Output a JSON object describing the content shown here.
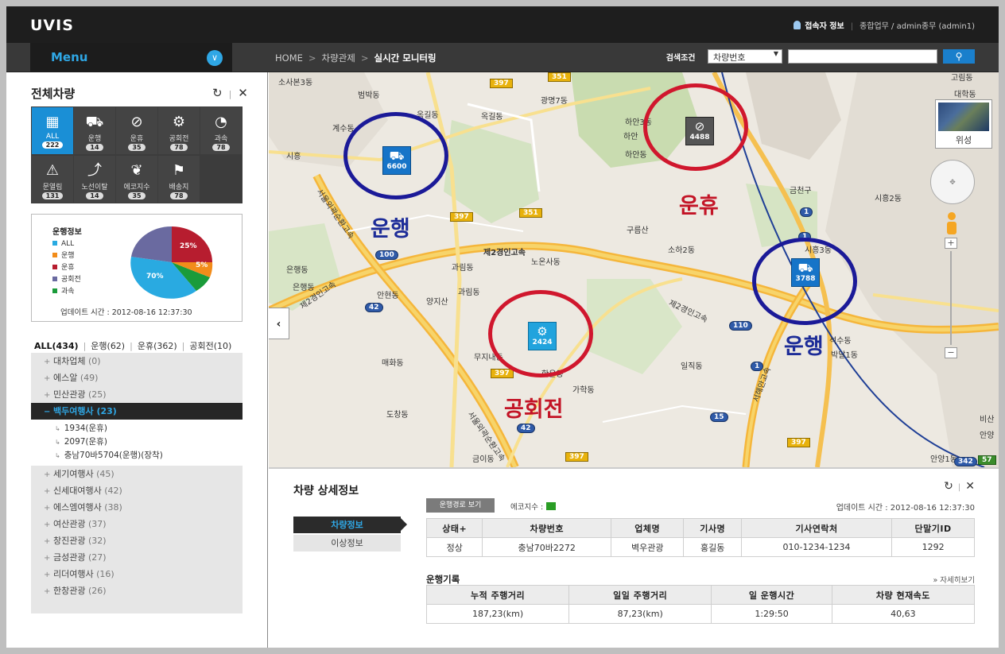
{
  "app": {
    "logo": "UVIS"
  },
  "user": {
    "label": "접속자 정보",
    "info": "종합업무 / admin종무 (admin1)"
  },
  "nav": {
    "menu_label": "Menu",
    "breadcrumb": [
      "HOME",
      "차량관제",
      "실시간 모니터링"
    ],
    "search_label": "검색조건",
    "search_select": "차량번호",
    "search_value": ""
  },
  "sidebar": {
    "title": "전체차량",
    "categories": [
      {
        "label": "ALL",
        "count": "222",
        "icon": "grid-icon"
      },
      {
        "label": "운행",
        "count": "14",
        "icon": "car-icon"
      },
      {
        "label": "운휴",
        "count": "35",
        "icon": "no-entry-icon"
      },
      {
        "label": "공회전",
        "count": "78",
        "icon": "gear-icon"
      },
      {
        "label": "과속",
        "count": "78",
        "icon": "speedometer-icon"
      },
      {
        "label": "문열림",
        "count": "131",
        "icon": "alert-icon"
      },
      {
        "label": "노선이탈",
        "count": "14",
        "icon": "detour-icon"
      },
      {
        "label": "에코지수",
        "count": "35",
        "icon": "leaf-icon"
      },
      {
        "label": "배송지",
        "count": "78",
        "icon": "flag-icon"
      }
    ],
    "pie": {
      "title": "운행정보",
      "legend": [
        {
          "label": "ALL",
          "color": "#29aae1"
        },
        {
          "label": "운행",
          "color": "#f28c1a"
        },
        {
          "label": "운휴",
          "color": "#b71d2f"
        },
        {
          "label": "공회전",
          "color": "#6a6aa0"
        },
        {
          "label": "과속",
          "color": "#1a9b3a"
        }
      ],
      "slice_labels": [
        "25%",
        "5%",
        "70%"
      ],
      "update": "업데이트 시간 : 2012-08-16 12:37:30"
    },
    "filter": [
      "ALL(434)",
      "운행(62)",
      "운휴(362)",
      "공회전(10)"
    ],
    "companies_top": [
      {
        "name": "대차업체",
        "count": "(0)"
      },
      {
        "name": "에스알",
        "count": "(49)"
      },
      {
        "name": "민산관광",
        "count": "(25)"
      }
    ],
    "open_company": {
      "name": "백두여행사",
      "count": "(23)"
    },
    "open_items": [
      "1934(운휴)",
      "2097(운휴)",
      "충남70바5704(운행)(장착)"
    ],
    "companies_bottom": [
      {
        "name": "세기여행사",
        "count": "(45)"
      },
      {
        "name": "신세대여행사",
        "count": "(42)"
      },
      {
        "name": "에스엠여행사",
        "count": "(38)"
      },
      {
        "name": "여산관광",
        "count": "(37)"
      },
      {
        "name": "창진관광",
        "count": "(32)"
      },
      {
        "name": "금성관광",
        "count": "(27)"
      },
      {
        "name": "리더여행사",
        "count": "(16)"
      },
      {
        "name": "한창관광",
        "count": "(26)"
      }
    ]
  },
  "map": {
    "satellite_label": "위성",
    "markers": [
      {
        "id": "6600",
        "status": "운행"
      },
      {
        "id": "4488",
        "status": "운휴"
      },
      {
        "id": "3788",
        "status": "운행"
      },
      {
        "id": "2424",
        "status": "공회전"
      }
    ],
    "places": [
      "소사본3동",
      "범박동",
      "옥길동",
      "광명7동",
      "옥길동",
      "하안3동",
      "하안동",
      "금천구",
      "시흥2동",
      "계수동",
      "시흥",
      "하안",
      "구름산",
      "소하2동",
      "시흥3동",
      "과림동",
      "노온사동",
      "은행동",
      "은행동",
      "안현동",
      "과림동",
      "양지산",
      "매화동",
      "무지내동",
      "학온동",
      "가학동",
      "일직동",
      "석수동",
      "박달1동",
      "도창동",
      "금이동",
      "비산",
      "안양1동",
      "대학동",
      "고림동",
      "안양"
    ],
    "roads": [
      "397",
      "351",
      "397",
      "351",
      "100",
      "42",
      "397",
      "110",
      "15",
      "42",
      "397",
      "397",
      "342",
      "57",
      "1",
      "1",
      "1"
    ],
    "road_names": [
      "제2경인고속",
      "제2경인고속",
      "제2경인고속",
      "서울외곽순환고속",
      "서울외곽순환고속",
      "서해안고속"
    ]
  },
  "detail": {
    "title": "차량 상세정보",
    "route_button": "운행경로 보기",
    "eco_label": "에코지수 :",
    "update": "업데이트 시간 : 2012-08-16 12:37:30",
    "tabs": [
      "차량정보",
      "이상정보"
    ],
    "table1": {
      "headers": [
        "상태+",
        "차량번호",
        "업체명",
        "기사명",
        "기사연락처",
        "단말기ID"
      ],
      "row": [
        "정상",
        "충남70바2272",
        "벽우관광",
        "홍길동",
        "010-1234-1234",
        "1292"
      ]
    },
    "records_title": "운행기록",
    "more": "자세히보기",
    "table2": {
      "headers": [
        "누적 주행거리",
        "일일 주행거리",
        "일 운행시간",
        "차량 현재속도"
      ],
      "row": [
        "187,23(km)",
        "87,23(km)",
        "1:29:50",
        "40,63"
      ]
    }
  }
}
